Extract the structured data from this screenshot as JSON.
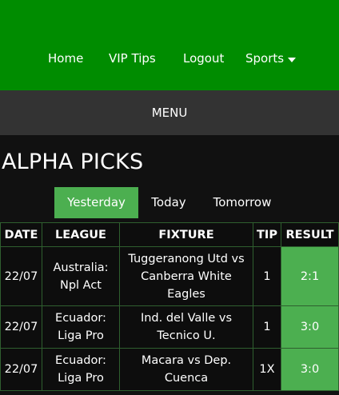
{
  "nav": {
    "items": [
      {
        "label": "Home"
      },
      {
        "label": "VIP Tips"
      },
      {
        "label": "Logout"
      },
      {
        "label": "Sports"
      }
    ]
  },
  "menu": {
    "label": "MENU"
  },
  "page": {
    "title": "ALPHA PICKS"
  },
  "tabs": [
    {
      "label": "Yesterday",
      "active": true
    },
    {
      "label": "Today",
      "active": false
    },
    {
      "label": "Tomorrow",
      "active": false
    }
  ],
  "table": {
    "headers": [
      "DATE",
      "LEAGUE",
      "FIXTURE",
      "TIP",
      "RESULT"
    ],
    "rows": [
      {
        "date": "22/07",
        "league": "Australia: Npl Act",
        "fixture": "Tuggeranong Utd vs Canberra White Eagles",
        "tip": "1",
        "result": "2:1"
      },
      {
        "date": "22/07",
        "league": "Ecuador: Liga Pro",
        "fixture": "Ind. del Valle vs Tecnico U.",
        "tip": "1",
        "result": "3:0"
      },
      {
        "date": "22/07",
        "league": "Ecuador: Liga Pro",
        "fixture": "Macara vs Dep. Cuenca",
        "tip": "1X",
        "result": "3:0"
      }
    ]
  },
  "colors": {
    "brand_green": "#008c00",
    "accent_green": "#4caf50",
    "menu_bar": "#333333",
    "background": "#111111"
  },
  "icons": {
    "sports_dropdown": "caret-down-icon"
  }
}
